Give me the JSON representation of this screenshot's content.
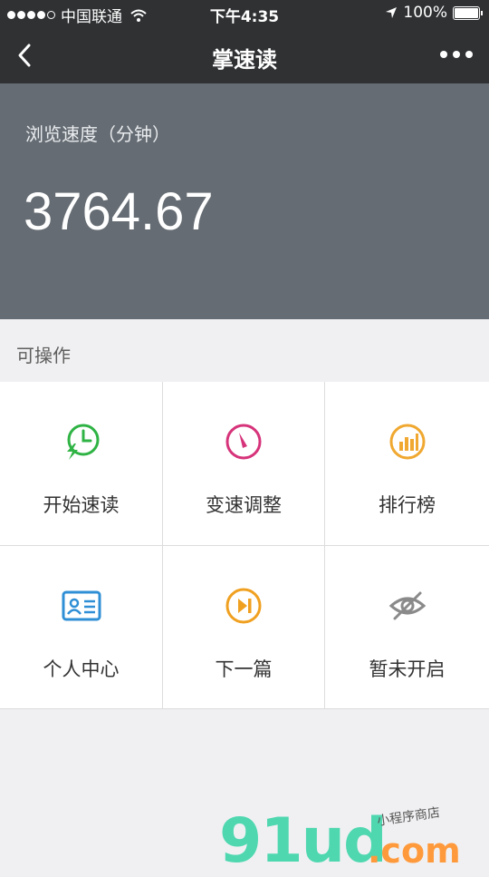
{
  "status_bar": {
    "carrier": "中国联通",
    "time": "下午4:35",
    "battery_percent": "100%",
    "battery_level": 1.0,
    "signal_bars_filled": 4,
    "icons": [
      "signal-dots-icon",
      "wifi-icon",
      "location-arrow-icon",
      "battery-icon"
    ]
  },
  "nav": {
    "title": "掌速读",
    "back_icon": "chevron-left-icon",
    "more_icon": "more-dots-icon"
  },
  "speed_panel": {
    "label": "浏览速度（分钟）",
    "value": "3764.67"
  },
  "actions": {
    "section_label": "可操作",
    "items": [
      {
        "label": "开始速读",
        "icon": "clock-lightning-icon",
        "color": "#2fb344"
      },
      {
        "label": "变速调整",
        "icon": "gauge-needle-icon",
        "color": "#d6337a"
      },
      {
        "label": "排行榜",
        "icon": "bar-chart-icon",
        "color": "#f0a830"
      },
      {
        "label": "个人中心",
        "icon": "id-card-icon",
        "color": "#2f8fd6"
      },
      {
        "label": "下一篇",
        "icon": "next-track-icon",
        "color": "#f0a020"
      },
      {
        "label": "暂未开启",
        "icon": "eye-off-icon",
        "color": "#8a8a8a"
      }
    ]
  },
  "watermark": {
    "main": "91ud",
    "suffix": ".com",
    "subtitle": "小程序商店"
  }
}
